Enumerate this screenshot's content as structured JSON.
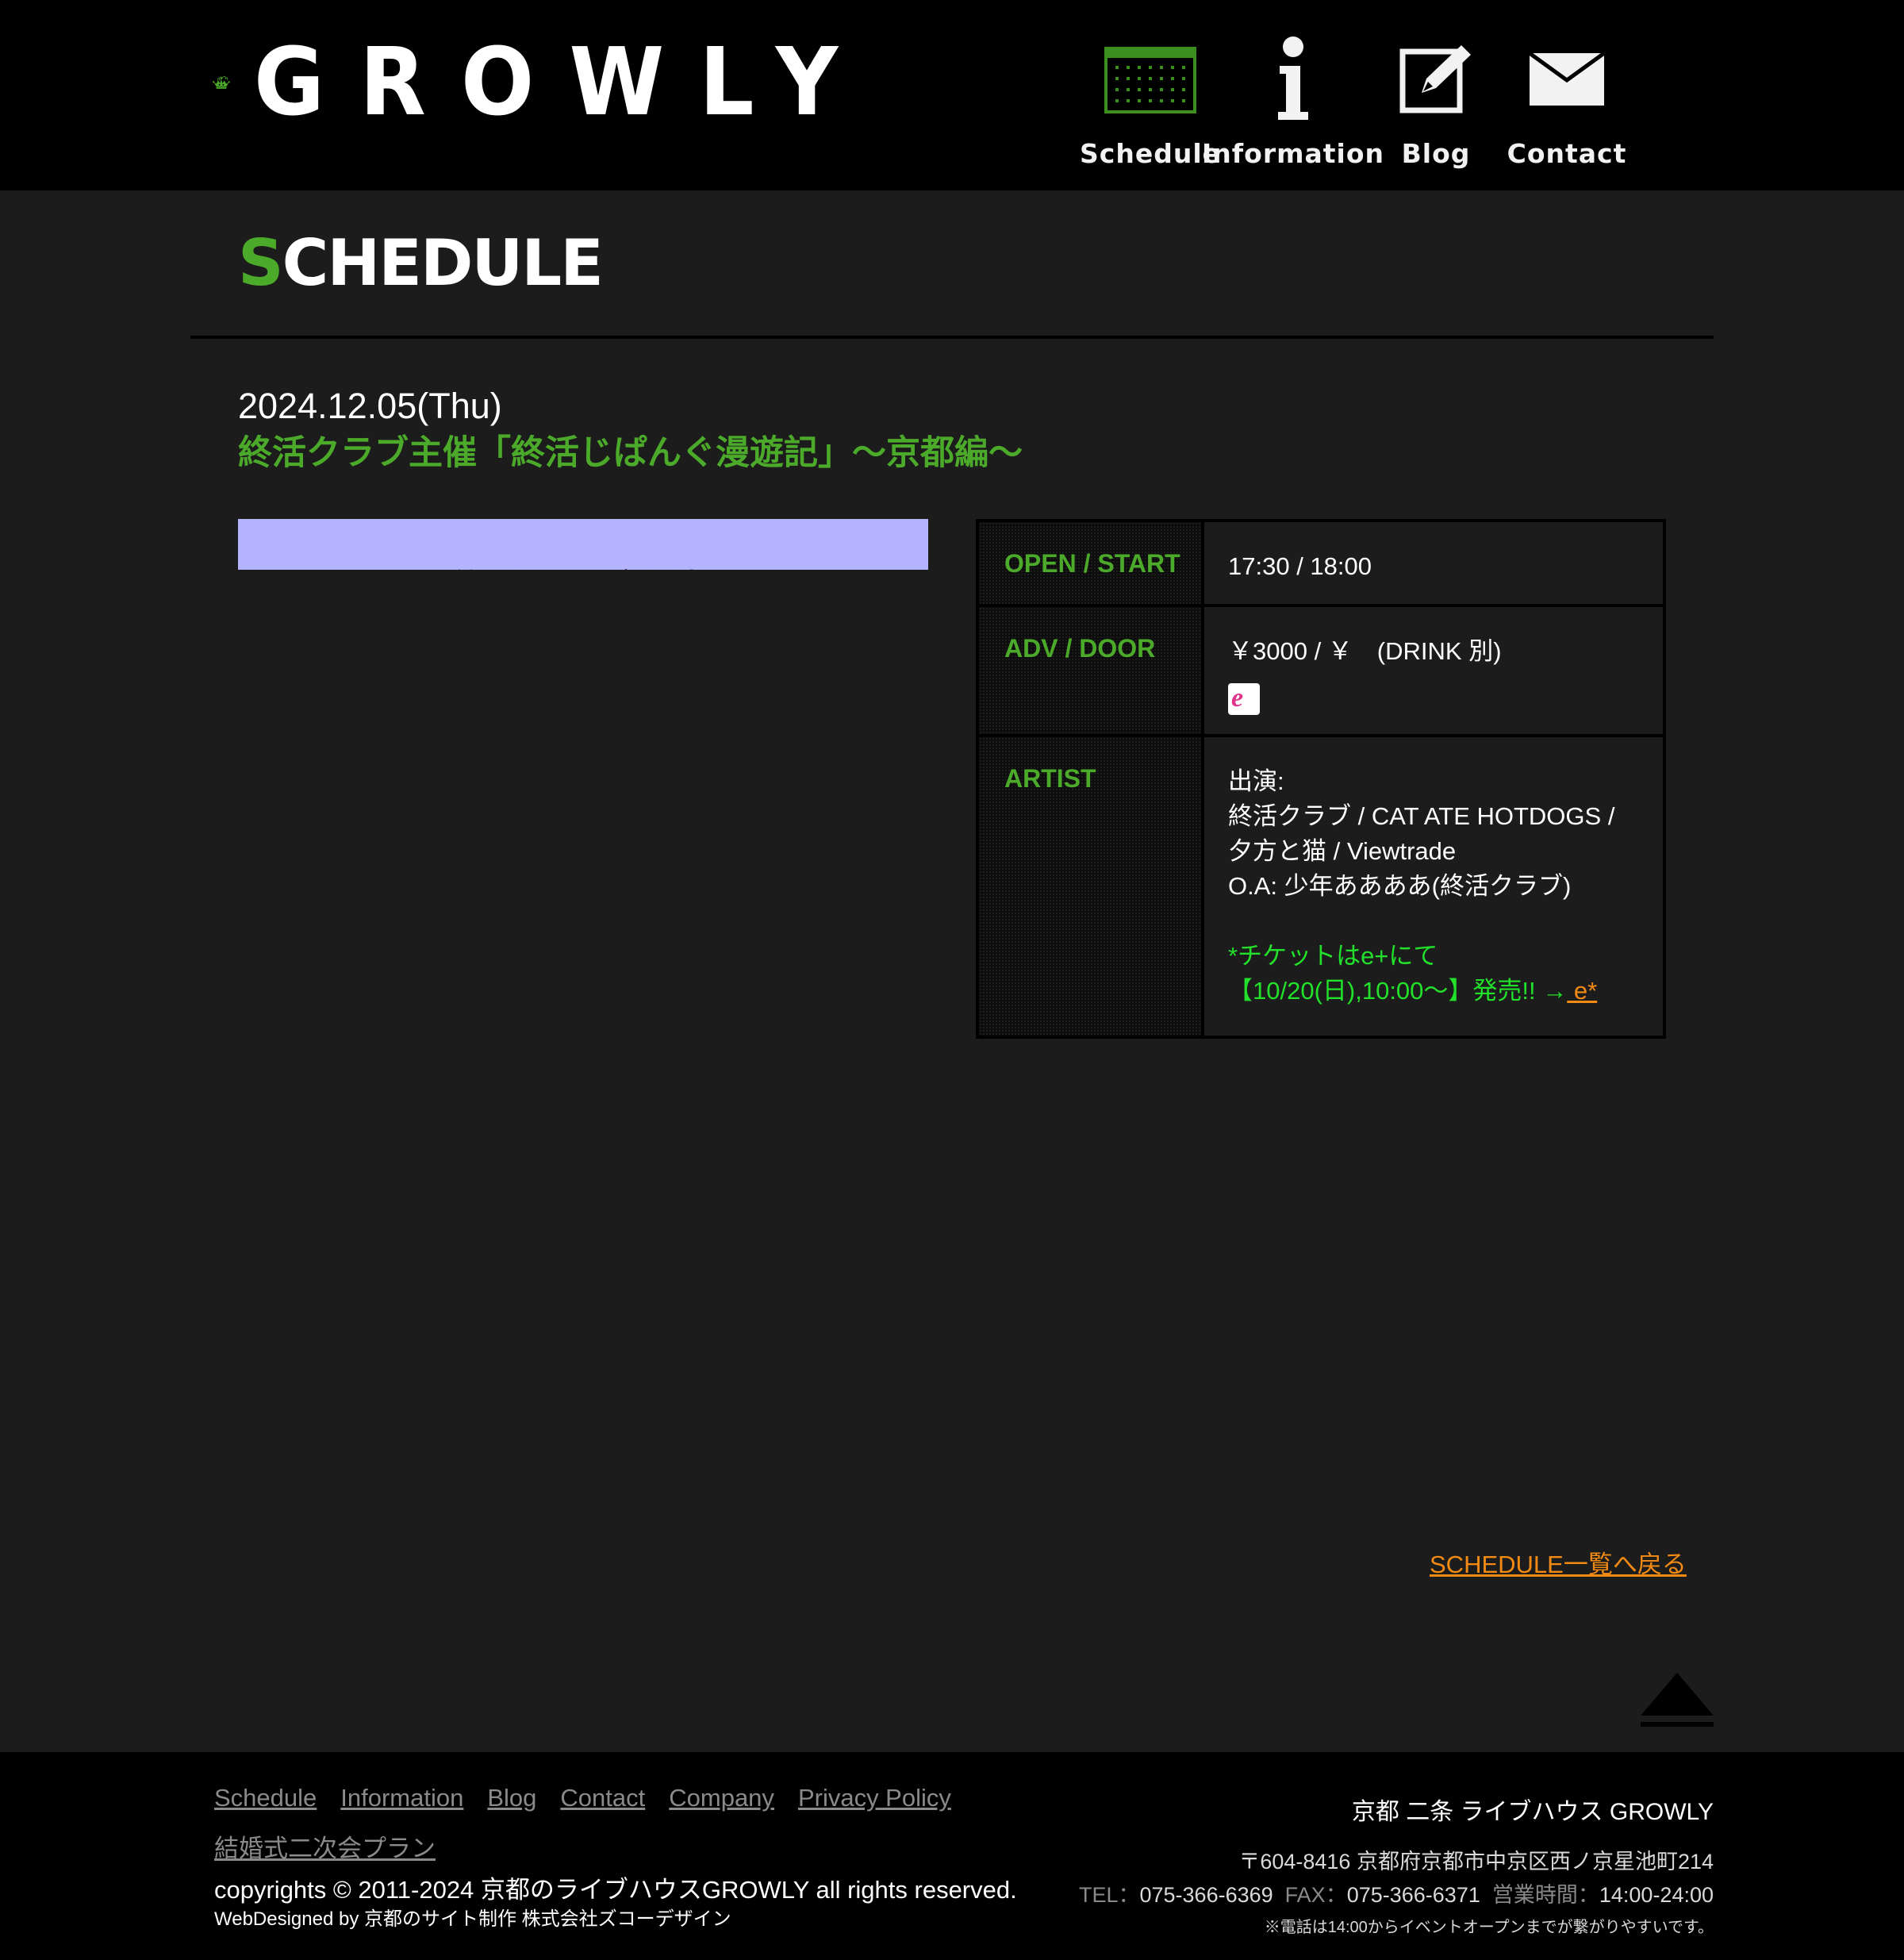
{
  "header": {
    "logo_text": "GROWLY",
    "nav": [
      {
        "label": "Schedule",
        "icon": "calendar-icon"
      },
      {
        "label": "Information",
        "icon": "info-icon"
      },
      {
        "label": "Blog",
        "icon": "pencil-note-icon"
      },
      {
        "label": "Contact",
        "icon": "envelope-icon"
      }
    ]
  },
  "page": {
    "title_first": "S",
    "title_rest": "CHEDULE",
    "event_date": "2024.12.05(Thu)",
    "event_title": "終活クラブ主催「終活じぱんぐ漫遊記」〜京都編〜"
  },
  "event": {
    "open_label": "OPEN / START",
    "open_value": "17:30 / 18:00",
    "adv_label": "ADV / DOOR",
    "adv_value": "￥3000 / ￥　(DRINK 別)",
    "ticket_vendor_icon": "eplus-icon",
    "artist_label": "ARTIST",
    "artist_lines": [
      "出演:",
      "終活クラブ / CAT ATE HOTDOGS / 夕方と猫 / Viewtrade",
      "O.A: 少年ああああ(終活クラブ)"
    ],
    "ticket_note": "*チケットはe+にて 【10/20(日),10:00〜】発売!! →",
    "ticket_link": " e*"
  },
  "back_link": "SCHEDULE一覧へ戻る",
  "footer": {
    "nav": [
      "Schedule",
      "Information",
      "Blog",
      "Contact",
      "Company",
      "Privacy Policy"
    ],
    "nav_second": "結婚式二次会プラン",
    "copyright": "copyrights © 2011-2024 京都のライブハウスGROWLY all rights reserved.",
    "webdesigned": "WebDesigned by 京都のサイト制作 株式会社ズコーデザイン",
    "venue_name": "京都 二条 ライブハウス GROWLY",
    "address": "〒604-8416 京都府京都市中京区西ノ京星池町214",
    "tel_label": "TEL：",
    "tel": "075-366-6369",
    "fax_label": "FAX：",
    "fax": "075-366-6371",
    "hours_label": "営業時間：",
    "hours": "14:00-24:00",
    "phone_note": "※電話は14:00からイベントオープンまでが繋がりやすいです。"
  },
  "colors": {
    "accent_green": "#4caa2a",
    "note_green": "#22e12a",
    "link_orange": "#f28a14",
    "background": "#1c1c1c"
  }
}
